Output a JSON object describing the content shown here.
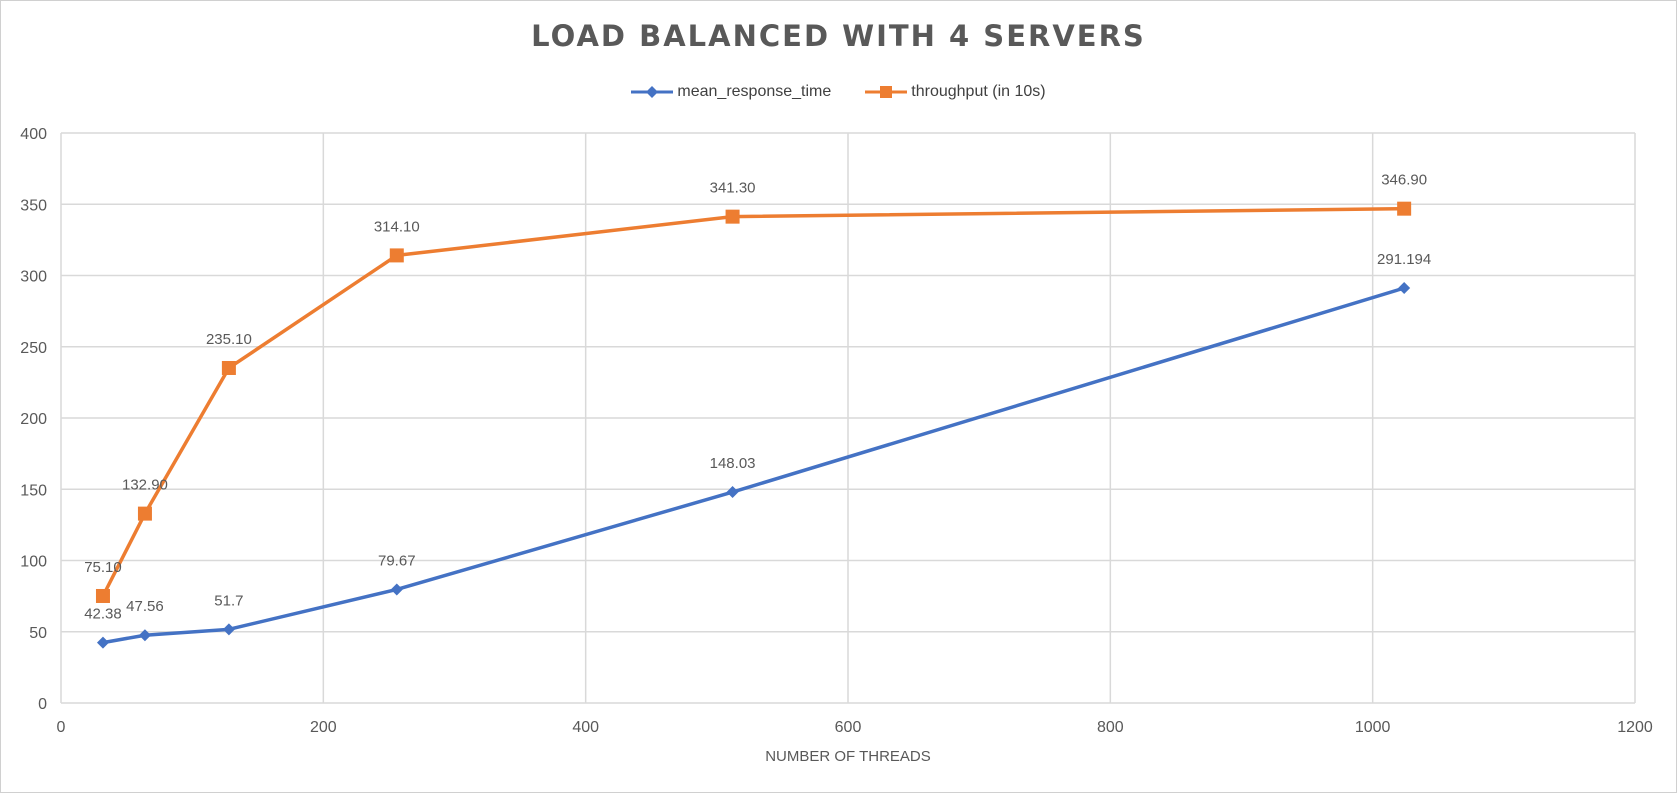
{
  "chart_data": {
    "type": "line",
    "title": "LOAD BALANCED WITH 4 SERVERS",
    "xlabel": "NUMBER OF THREADS",
    "ylabel": "",
    "xlim": [
      0,
      1200
    ],
    "ylim": [
      0,
      400
    ],
    "x_ticks": [
      0,
      200,
      400,
      600,
      800,
      1000,
      1200
    ],
    "y_ticks": [
      0,
      50,
      100,
      150,
      200,
      250,
      300,
      350,
      400
    ],
    "grid": true,
    "legend_position": "top",
    "series": [
      {
        "name": "mean_response_time",
        "color": "#4472C4",
        "marker": "diamond",
        "x": [
          32,
          64,
          128,
          256,
          512,
          1024
        ],
        "y": [
          42.38,
          47.56,
          51.7,
          79.67,
          148.03,
          291.194
        ],
        "labels": [
          "42.38",
          "47.56",
          "51.7",
          "79.67",
          "148.03",
          "291.194"
        ]
      },
      {
        "name": "throughput (in 10s)",
        "color": "#ED7D31",
        "marker": "square",
        "x": [
          32,
          64,
          128,
          256,
          512,
          1024
        ],
        "y": [
          75.1,
          132.9,
          235.1,
          314.1,
          341.3,
          346.9
        ],
        "labels": [
          "75.10",
          "132.90",
          "235.10",
          "314.10",
          "341.30",
          "346.90"
        ]
      }
    ]
  }
}
